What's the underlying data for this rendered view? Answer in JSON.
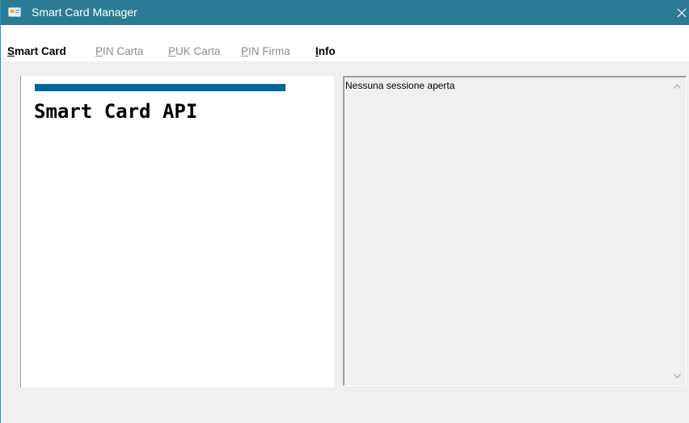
{
  "window": {
    "title": "Smart Card Manager",
    "title_bar_color": "#2b7b95"
  },
  "menu": {
    "items": [
      {
        "accel": "S",
        "rest": "mart Card",
        "enabled": true
      },
      {
        "accel": "P",
        "rest": "IN Carta",
        "enabled": false
      },
      {
        "accel": "P",
        "rest": "UK Carta",
        "enabled": false
      },
      {
        "accel": "P",
        "rest": "IN Firma",
        "enabled": false
      },
      {
        "accel": "I",
        "rest": "nfo",
        "enabled": true
      }
    ]
  },
  "left_panel": {
    "heading": "Smart Card API",
    "accent_color": "#0066a1"
  },
  "log": {
    "text": "Nessuna sessione aperta"
  }
}
